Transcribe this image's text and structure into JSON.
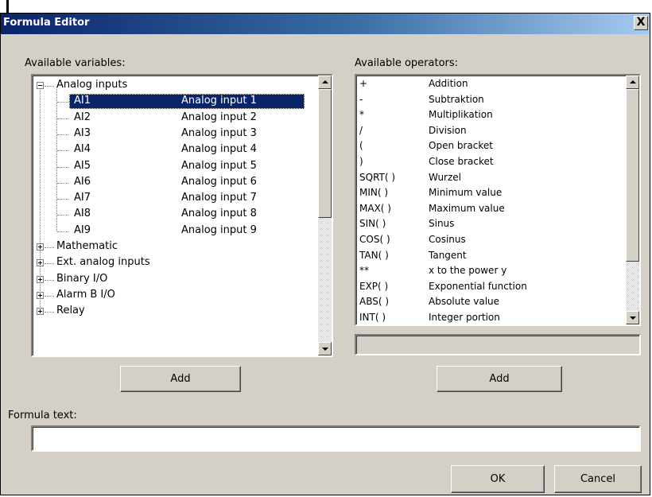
{
  "window": {
    "title": "Formula Editor",
    "close_label": "X"
  },
  "labels": {
    "variables": "Available variables:",
    "operators": "Available operators:",
    "formula": "Formula text:"
  },
  "tree": {
    "groups": [
      {
        "label": "Analog inputs",
        "expanded": true
      },
      {
        "label": "Mathematic",
        "expanded": false
      },
      {
        "label": "Ext. analog inputs",
        "expanded": false
      },
      {
        "label": "Binary I/O",
        "expanded": false
      },
      {
        "label": "Alarm B I/O",
        "expanded": false
      },
      {
        "label": "Relay",
        "expanded": false
      }
    ],
    "items": [
      {
        "name": "AI1",
        "desc": "Analog input 1",
        "selected": true
      },
      {
        "name": "AI2",
        "desc": "Analog input 2"
      },
      {
        "name": "AI3",
        "desc": "Analog input 3"
      },
      {
        "name": "AI4",
        "desc": "Analog input 4"
      },
      {
        "name": "AI5",
        "desc": "Analog input 5"
      },
      {
        "name": "AI6",
        "desc": "Analog input 6"
      },
      {
        "name": "AI7",
        "desc": "Analog input 7"
      },
      {
        "name": "AI8",
        "desc": "Analog input 8"
      },
      {
        "name": "AI9",
        "desc": "Analog input 9"
      }
    ]
  },
  "operators": [
    {
      "sym": "+",
      "desc": "Addition"
    },
    {
      "sym": "-",
      "desc": "Subtraktion"
    },
    {
      "sym": "*",
      "desc": "Multiplikation"
    },
    {
      "sym": "/",
      "desc": "Division"
    },
    {
      "sym": "(",
      "desc": "Open bracket"
    },
    {
      "sym": ")",
      "desc": "Close bracket"
    },
    {
      "sym": "SQRT( )",
      "desc": "Wurzel"
    },
    {
      "sym": "MIN( )",
      "desc": "Minimum value"
    },
    {
      "sym": "MAX( )",
      "desc": "Maximum value"
    },
    {
      "sym": "SIN( )",
      "desc": "Sinus"
    },
    {
      "sym": "COS( )",
      "desc": "Cosinus"
    },
    {
      "sym": "TAN( )",
      "desc": "Tangent"
    },
    {
      "sym": "**",
      "desc": "x to the power y"
    },
    {
      "sym": "EXP( )",
      "desc": "Exponential function"
    },
    {
      "sym": "ABS( )",
      "desc": "Absolute value"
    },
    {
      "sym": "INT( )",
      "desc": "Integer portion"
    }
  ],
  "buttons": {
    "add_variable": "Add",
    "add_operator": "Add",
    "ok": "OK",
    "cancel": "Cancel"
  },
  "formula_text": {
    "value": ""
  },
  "colors": {
    "selection": "#0a246a",
    "titlebar": "#0a246a",
    "dialog": "#d4d0c8"
  }
}
